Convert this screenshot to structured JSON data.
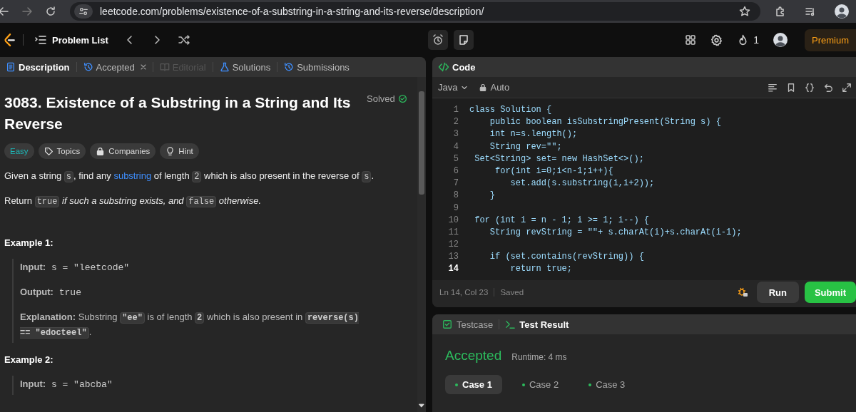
{
  "browser": {
    "url": "leetcode.com/problems/existence-of-a-substring-in-a-string-and-its-reverse/description/"
  },
  "nav": {
    "title": "Problem List",
    "streak": "1",
    "premium": "Premium"
  },
  "tabs": [
    {
      "label": "Description",
      "kind": "doc",
      "selected": true,
      "disabled": false,
      "closable": false
    },
    {
      "label": "Accepted",
      "kind": "history",
      "selected": false,
      "disabled": false,
      "closable": true
    },
    {
      "label": "Editorial",
      "kind": "book",
      "selected": false,
      "disabled": true,
      "closable": false
    },
    {
      "label": "Solutions",
      "kind": "flask",
      "selected": false,
      "disabled": false,
      "closable": false
    },
    {
      "label": "Submissions",
      "kind": "history",
      "selected": false,
      "disabled": false,
      "closable": false
    }
  ],
  "problem": {
    "title": "3083. Existence of a Substring in a String and Its Reverse",
    "status": "Solved",
    "difficulty": "Easy",
    "chips": [
      {
        "label": "Topics",
        "kind": "tag"
      },
      {
        "label": "Companies",
        "kind": "lock"
      },
      {
        "label": "Hint",
        "kind": "bulb"
      }
    ],
    "paragraphs": [
      [
        {
          "kind": "text",
          "text": "Given a string "
        },
        {
          "kind": "code",
          "text": "s"
        },
        {
          "kind": "text",
          "text": ", find any "
        },
        {
          "kind": "link",
          "text": "substring"
        },
        {
          "kind": "text",
          "text": " of length "
        },
        {
          "kind": "code",
          "text": "2"
        },
        {
          "kind": "text",
          "text": " which is also present in the reverse of "
        },
        {
          "kind": "code",
          "text": "s"
        },
        {
          "kind": "text",
          "text": "."
        }
      ],
      [
        {
          "kind": "text",
          "text": "Return "
        },
        {
          "kind": "code",
          "text": "true"
        },
        {
          "kind": "italic",
          "text": " if such a substring exists, and "
        },
        {
          "kind": "code",
          "text": "false"
        },
        {
          "kind": "italic",
          "text": " otherwise."
        }
      ]
    ],
    "examples": [
      {
        "title": "Example 1:",
        "lines": [
          [
            {
              "kind": "bold",
              "text": "Input:"
            },
            {
              "kind": "mono",
              "text": " s = \"leetcode\""
            }
          ],
          [
            {
              "kind": "bold",
              "text": "Output:"
            },
            {
              "kind": "mono",
              "text": " true"
            }
          ],
          [
            {
              "kind": "bold",
              "text": "Explanation:"
            },
            {
              "kind": "text",
              "text": " Substring "
            },
            {
              "kind": "code",
              "text": "\"ee\""
            },
            {
              "kind": "text",
              "text": " is of length "
            },
            {
              "kind": "code",
              "text": "2"
            },
            {
              "kind": "text",
              "text": " which is also present in "
            },
            {
              "kind": "code",
              "text": "reverse(s) == \"edocteel\""
            },
            {
              "kind": "text",
              "text": "."
            }
          ]
        ]
      },
      {
        "title": "Example 2:",
        "lines": [
          [
            {
              "kind": "bold",
              "text": "Input:"
            },
            {
              "kind": "mono",
              "text": " s = \"abcba\""
            }
          ]
        ]
      }
    ]
  },
  "editor": {
    "title": "Code",
    "language": "Java",
    "mode": "Auto",
    "lines": [
      {
        "number": "1",
        "text": "class Solution {",
        "current": false
      },
      {
        "number": "2",
        "text": "    public boolean isSubstringPresent(String s) {",
        "current": false
      },
      {
        "number": "3",
        "text": "    int n=s.length();",
        "current": false
      },
      {
        "number": "4",
        "text": "    String rev=\"\";",
        "current": false
      },
      {
        "number": "5",
        "text": " Set<String> set= new HashSet<>();",
        "current": false
      },
      {
        "number": "6",
        "text": "     for(int i=0;i<n-1;i++){",
        "current": false
      },
      {
        "number": "7",
        "text": "        set.add(s.substring(i,i+2));",
        "current": false
      },
      {
        "number": "8",
        "text": "    }",
        "current": false
      },
      {
        "number": "9",
        "current": false
      },
      {
        "number": "10",
        "text": " for (int i = n - 1; i >= 1; i--) {",
        "current": false
      },
      {
        "number": "11",
        "text": "    String revString = \"\"+ s.charAt(i)+s.charAt(i-1);",
        "current": false
      },
      {
        "number": "12",
        "current": false
      },
      {
        "number": "13",
        "text": "    if (set.contains(revString)) {",
        "current": false
      },
      {
        "number": "14",
        "text": "        return true;",
        "current": true
      }
    ],
    "position": "Ln 14, Col 23",
    "save_state": "Saved",
    "run": "Run",
    "submit": "Submit"
  },
  "result": {
    "tabs": [
      {
        "label": "Testcase",
        "kind": "check",
        "selected": false
      },
      {
        "label": "Test Result",
        "kind": "terminal",
        "selected": true
      }
    ],
    "verdict": "Accepted",
    "runtime": "Runtime: 4 ms",
    "cases": [
      {
        "label": "Case 1",
        "selected": true
      },
      {
        "label": "Case 2",
        "selected": false
      },
      {
        "label": "Case 3",
        "selected": false
      }
    ]
  }
}
